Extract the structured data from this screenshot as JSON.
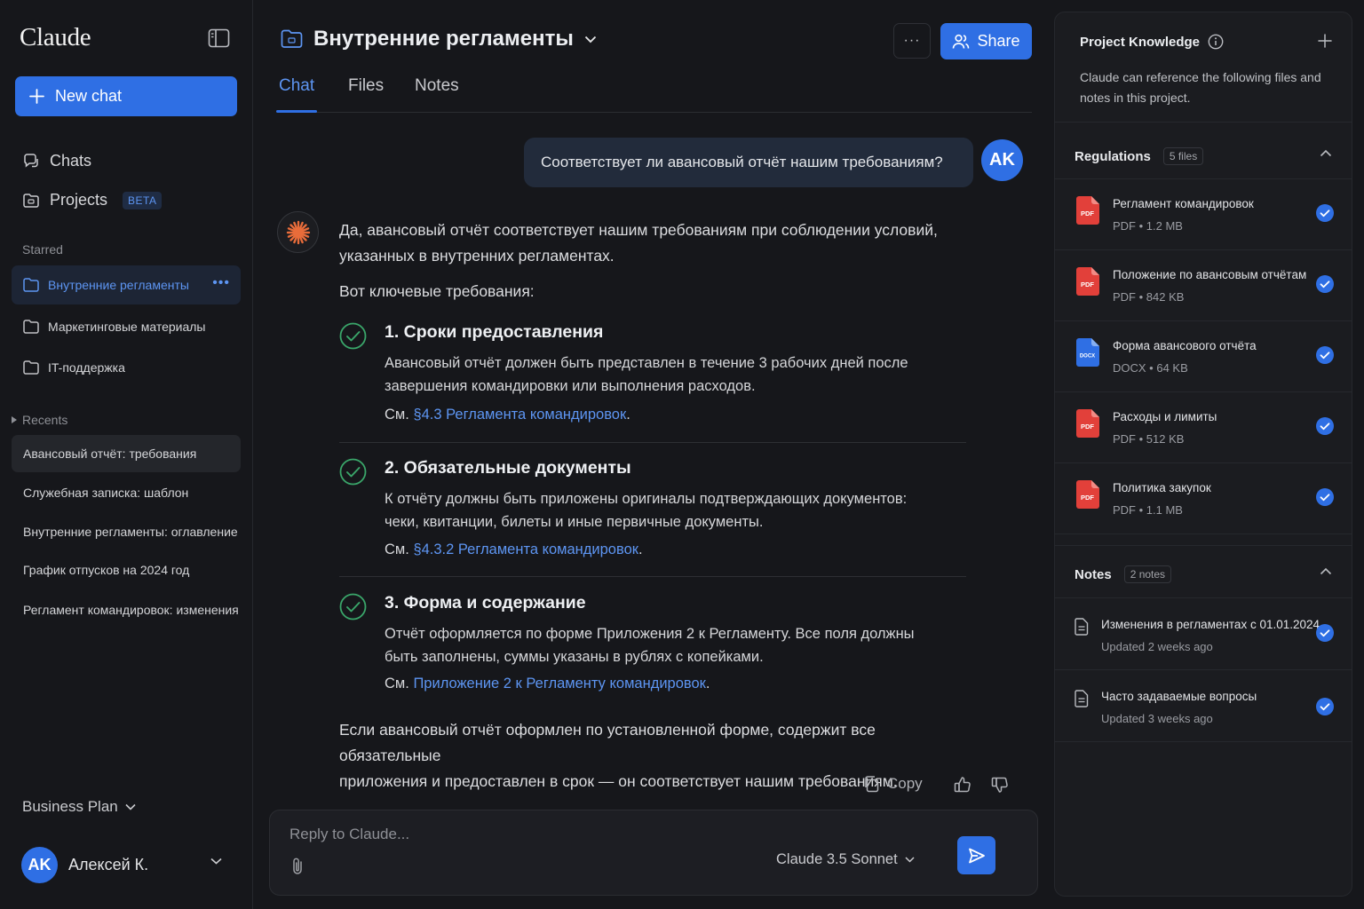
{
  "sidebar": {
    "logo": "Claude",
    "new_chat": "New chat",
    "nav": {
      "chats": "Chats",
      "projects": "Projects",
      "beta": "BETA"
    },
    "starred_label": "Starred",
    "starred": [
      "Внутренние регламенты",
      "Маркетинговые материалы",
      "IT-поддержка"
    ],
    "recents_label": "Recents",
    "recents": [
      "Авансовый отчёт: требования",
      "Служебная записка: шаблон",
      "Внутренние регламенты: оглавление",
      "График отпусков на 2024 год",
      "Регламент командировок: изменения"
    ],
    "plan": "Business Plan",
    "user": {
      "initials": "AK",
      "name": "Алексей К."
    }
  },
  "header": {
    "project_title": "Внутренние регламенты",
    "more": "···",
    "share": "Share",
    "tabs": [
      "Chat",
      "Files",
      "Notes"
    ]
  },
  "chat": {
    "user_message": "Соответствует ли авансовый отчёт нашим требованиям?",
    "user_initials": "AK",
    "intro_line1": "Да, авансовый отчёт соответствует нашим требованиям при соблюдении условий,",
    "intro_line2": "указанных в внутренних регламентах.",
    "key_req": "Вот ключевые требования:",
    "requirements": [
      {
        "title": "1. Сроки предоставления",
        "line1": "Авансовый отчёт должен быть представлен в течение 3 рабочих дней после",
        "line2": "завершения командировки или выполнения расходов.",
        "ref_prefix": "См. ",
        "ref_link": "§4.3 Регламента командировок",
        "ref_suffix": "."
      },
      {
        "title": "2. Обязательные документы",
        "line1": "К отчёту должны быть приложены оригиналы подтверждающих документов:",
        "line2": "чеки, квитанции, билеты и иные первичные документы.",
        "ref_prefix": "См. ",
        "ref_link": "§4.3.2 Регламента командировок",
        "ref_suffix": "."
      },
      {
        "title": "3. Форма и содержание",
        "line1": "Отчёт оформляется по форме Приложения 2 к Регламенту. Все поля должны",
        "line2": "быть заполнены, суммы указаны в рублях с копейками.",
        "ref_prefix": "См. ",
        "ref_link": "Приложение 2 к Регламенту командировок",
        "ref_suffix": "."
      }
    ],
    "conclusion_line1": "Если авансовый отчёт оформлен по установленной форме, содержит все обязательные",
    "conclusion_line2": "приложения и предоставлен в срок — он соответствует нашим требованиям.",
    "copy": "Copy"
  },
  "composer": {
    "placeholder": "Reply to Claude...",
    "model": "Claude 3.5 Sonnet"
  },
  "knowledge": {
    "title": "Project Knowledge",
    "description": "Claude can reference the following files and notes in this project.",
    "regulations_label": "Regulations",
    "regulations_count": "5 files",
    "files": [
      {
        "name": "Регламент командировок",
        "type": "PDF",
        "size": "1.2 MB"
      },
      {
        "name": "Положение по авансовым отчётам",
        "type": "PDF",
        "size": "842 KB"
      },
      {
        "name": "Форма авансового отчёта",
        "type": "DOCX",
        "size": "64 KB"
      },
      {
        "name": "Расходы и лимиты",
        "type": "PDF",
        "size": "512 KB"
      },
      {
        "name": "Политика закупок",
        "type": "PDF",
        "size": "1.1 MB"
      }
    ],
    "notes_label": "Notes",
    "notes_count": "2 notes",
    "notes": [
      {
        "name": "Изменения в регламентах с 01.01.2024",
        "updated": "Updated 2 weeks ago"
      },
      {
        "name": "Часто задаваемые вопросы",
        "updated": "Updated 3 weeks ago"
      }
    ]
  },
  "colors": {
    "accent": "#2f6fe4",
    "link": "#5d95f2",
    "success": "#3aa66a",
    "pdf": "#e2403a",
    "docx": "#2f6fe4"
  }
}
